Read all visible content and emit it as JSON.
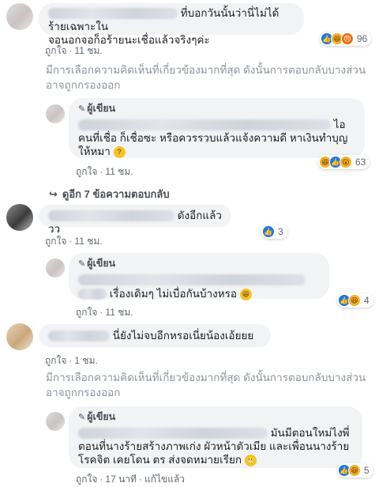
{
  "comments": [
    {
      "text_tail": "ที่บอกวันนั้นว่านี่ไม่ได้ร้ายเฉพาะใน",
      "text_line2": "จอนอกจอก็อร้ายนะเชื่อแล้วจริงๆค่ะ",
      "reaction_count": "96",
      "like_label": "ถูกใจ",
      "time": "11 ชม."
    },
    {
      "text_tail": "ดังอีกแล้ววว",
      "reaction_count": "3",
      "like_label": "ถูกใจ",
      "time": "11 ชม."
    },
    {
      "text_tail": "นี่ยังไม่จบอีกหรอเนี่ยน้องเอ้ยยย",
      "like_label": "ถูกใจ",
      "time": "1 ชม."
    }
  ],
  "replies": [
    {
      "author": "ผู้เขียน",
      "text_tail": "ไอ",
      "text_line2": "คนที่เชื่อ ก็เชื่อซะ หรือควรรวบแล้วแจ้งความดี หาเงินทำบุญ",
      "text_line3": "ให้หมา",
      "reaction_count": "63",
      "like_label": "ถูกใจ",
      "time": "11 ชม."
    },
    {
      "author": "ผู้เขียน",
      "text_tail": "เรื่องเดิมๆ ไม่เบื่อกันบ้างหรอ",
      "reaction_count": "4",
      "like_label": "ถูกใจ",
      "time": "11 ชม."
    },
    {
      "author": "ผู้เขียน",
      "text_tail": "มันมีตอนใหม่ไงพี่",
      "text_line2": "ตอนที่นางร้ายสร้างภาพเก่ง ผัวหน้าตัวเมีย และเพื่อนนางร้าย",
      "text_line3": "โรคจิต เคยโดน ตร ส่งจดหมายเรียก",
      "reaction_count": "5",
      "like_label": "ถูกใจ",
      "time": "17 นาที",
      "edited": "แก้ไขแล้ว"
    }
  ],
  "filter_notice_line1": "มีการเลือกความคิดเห็นที่เกี่ยวข้องมากที่สุด ดังนั้นการตอบกลับบางส่วน",
  "filter_notice_line2": "อาจถูกกรองออก",
  "view_more_replies": "ดูอีก 7 ข้อความตอบกลับ",
  "dot": "·"
}
